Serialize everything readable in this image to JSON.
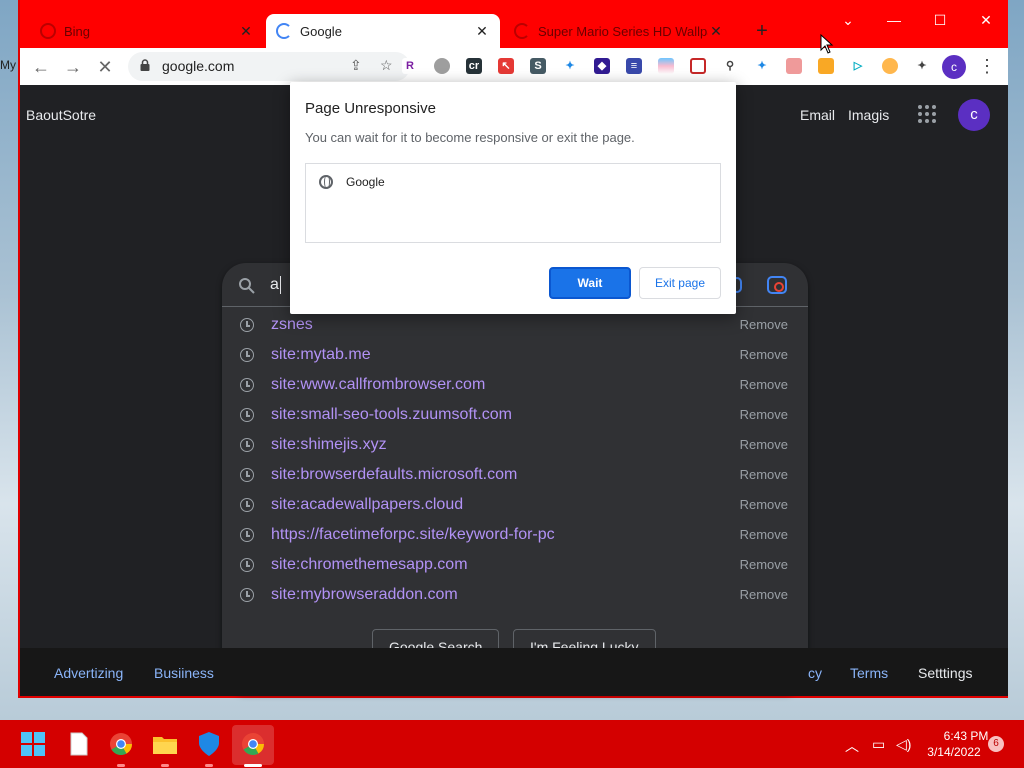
{
  "desktop": {
    "label": "My"
  },
  "browser": {
    "tabs": [
      {
        "title": "Bing",
        "state": "inactive"
      },
      {
        "title": "Google",
        "state": "active"
      },
      {
        "title": "Super Mario Series HD Wallpa",
        "state": "inactive"
      }
    ],
    "new_tab_symbol": "+",
    "window_controls": {
      "dropdown": "⌄",
      "minimize": "—",
      "maximize": "☐",
      "close": "✕"
    },
    "url": "google.com",
    "avatar_letter": "c"
  },
  "page": {
    "brand": "BaoutSotre",
    "top_links": {
      "email": "Email",
      "images": "Imagis"
    },
    "avatar_letter": "c",
    "search": {
      "query": "a",
      "suggestions": [
        {
          "text": "zsnes",
          "action": "Remove"
        },
        {
          "text": "site:mytab.me",
          "action": "Remove"
        },
        {
          "text": "site:www.callfrombrowser.com",
          "action": "Remove"
        },
        {
          "text": "site:small-seo-tools.zuumsoft.com",
          "action": "Remove"
        },
        {
          "text": "site:shimejis.xyz",
          "action": "Remove"
        },
        {
          "text": "site:browserdefaults.microsoft.com",
          "action": "Remove"
        },
        {
          "text": "site:acadewallpapers.cloud",
          "action": "Remove"
        },
        {
          "text": "https://facetimeforpc.site/keyword-for-pc",
          "action": "Remove"
        },
        {
          "text": "site:chromethemesapp.com",
          "action": "Remove"
        },
        {
          "text": "site:mybrowseraddon.com",
          "action": "Remove"
        }
      ],
      "google_search_label": "Google Search",
      "lucky_label": "I'm Feeling Lucky"
    },
    "footer": {
      "advertising": "Advertizing",
      "business": "Busiiness",
      "privacy": "cy",
      "terms": "Terms",
      "settings": "Setttings"
    }
  },
  "dialog": {
    "title": "Page Unresponsive",
    "message": "You can wait for it to become responsive or exit the page.",
    "page_name": "Google",
    "wait_label": "Wait",
    "exit_label": "Exit page"
  },
  "taskbar": {
    "time": "6:43 PM",
    "date": "3/14/2022",
    "notification_count": "6"
  },
  "colors": {
    "window_frame": "#ff0000",
    "taskbar": "#d40000",
    "page_bg": "#202124",
    "suggestion_text": "#b292f5",
    "link": "#8ab4f8",
    "primary_button": "#1a73e8"
  }
}
